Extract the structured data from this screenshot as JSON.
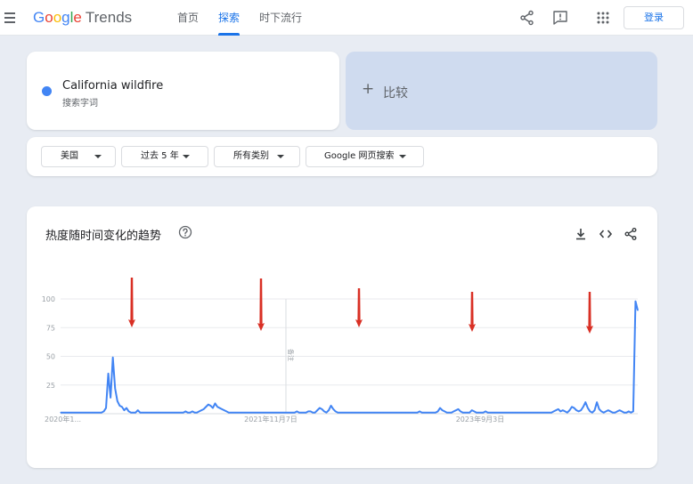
{
  "header": {
    "logo_letters": [
      "G",
      "o",
      "o",
      "g",
      "l",
      "e"
    ],
    "logo_suffix": "Trends",
    "nav": [
      {
        "label": "首页",
        "active": false
      },
      {
        "label": "探索",
        "active": true
      },
      {
        "label": "时下流行",
        "active": false
      }
    ],
    "login_label": "登录"
  },
  "search_term": {
    "name": "California wildfire",
    "type": "搜索字词",
    "color": "#4285f4"
  },
  "compare": {
    "plus": "+",
    "label": "比较"
  },
  "filters": {
    "region": "美国",
    "time_range": "过去 5 年",
    "category": "所有类别",
    "search_type": "Google 网页搜索"
  },
  "chart_card": {
    "title": "热度随时间变化的趋势"
  },
  "chart_data": {
    "type": "line",
    "title": "热度随时间变化的趋势",
    "x_tick_labels": [
      "2020年1...",
      "2021年11月7日",
      "2023年9月3日"
    ],
    "y_ticks": [
      100,
      75,
      50,
      25
    ],
    "ylim": [
      0,
      100
    ],
    "grid": true,
    "annotation_label": "备注",
    "line_color": "#4285f4",
    "series": [
      {
        "name": "California wildfire",
        "values": [
          1,
          1,
          1,
          1,
          1,
          1,
          1,
          1,
          1,
          1,
          1,
          1,
          1,
          1,
          1,
          1,
          1,
          1,
          1,
          2,
          5,
          35,
          14,
          49,
          22,
          11,
          7,
          6,
          3,
          5,
          2,
          1,
          1,
          1,
          3,
          1,
          1,
          1,
          1,
          1,
          1,
          1,
          1,
          1,
          1,
          1,
          1,
          1,
          1,
          1,
          1,
          1,
          1,
          1,
          1,
          2,
          1,
          1,
          2,
          1,
          1,
          2,
          3,
          4,
          6,
          8,
          7,
          5,
          9,
          6,
          5,
          4,
          3,
          2,
          1,
          1,
          1,
          1,
          1,
          1,
          1,
          1,
          1,
          1,
          1,
          1,
          1,
          1,
          1,
          1,
          1,
          1,
          1,
          1,
          1,
          1,
          1,
          1,
          1,
          1,
          1,
          1,
          1,
          1,
          2,
          1,
          1,
          1,
          1,
          2,
          2,
          1,
          1,
          3,
          5,
          4,
          2,
          1,
          3,
          7,
          4,
          2,
          1,
          1,
          1,
          1,
          1,
          1,
          1,
          1,
          1,
          1,
          1,
          1,
          1,
          1,
          1,
          1,
          1,
          1,
          1,
          1,
          1,
          1,
          1,
          1,
          1,
          1,
          1,
          1,
          1,
          1,
          1,
          1,
          1,
          1,
          1,
          1,
          2,
          1,
          1,
          1,
          1,
          1,
          1,
          1,
          2,
          5,
          3,
          2,
          1,
          1,
          1,
          2,
          3,
          4,
          2,
          1,
          1,
          1,
          1,
          3,
          2,
          1,
          1,
          1,
          1,
          2,
          1,
          1,
          1,
          1,
          1,
          1,
          1,
          1,
          1,
          1,
          1,
          1,
          1,
          1,
          1,
          1,
          1,
          1,
          1,
          1,
          1,
          1,
          1,
          1,
          1,
          1,
          1,
          1,
          1,
          2,
          3,
          4,
          2,
          3,
          2,
          1,
          3,
          6,
          5,
          3,
          2,
          3,
          6,
          10,
          5,
          2,
          1,
          3,
          10,
          4,
          2,
          1,
          2,
          3,
          2,
          1,
          1,
          2,
          3,
          2,
          1,
          1,
          2,
          1,
          2,
          98,
          90
        ]
      }
    ]
  },
  "annotations": {
    "arrow_color": "#d93025"
  }
}
